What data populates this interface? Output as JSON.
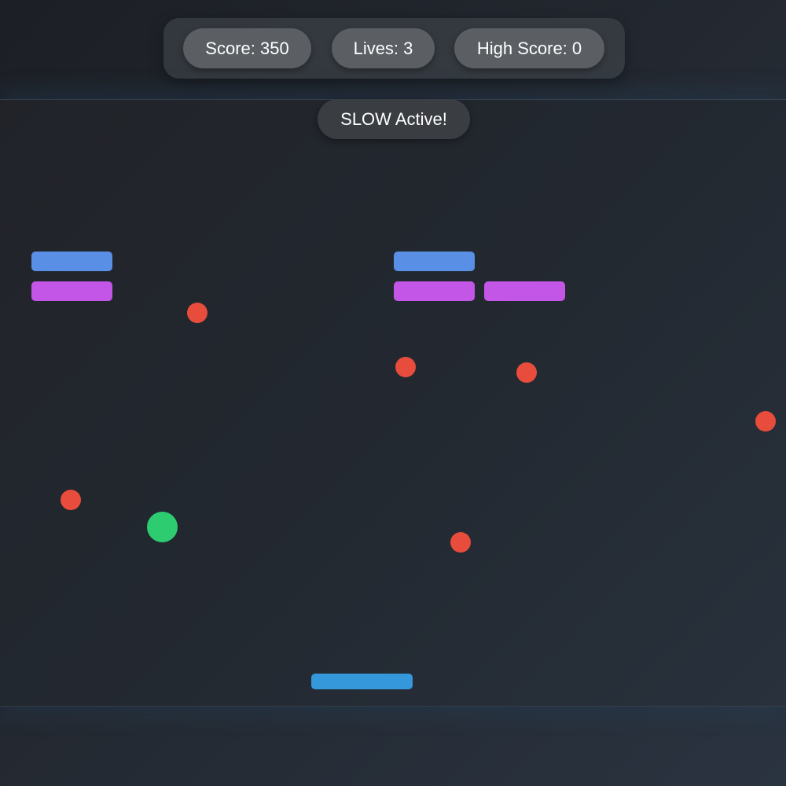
{
  "hud": {
    "score_text": "Score: 350",
    "lives_text": "Lives: 3",
    "high_score_text": "High Score: 0"
  },
  "powerup": {
    "banner_text": "SLOW Active!"
  },
  "colors": {
    "brick_blue": "#5a8fe6",
    "brick_purple": "#c356e6",
    "hazard_ball": "#e74c3c",
    "player_ball": "#2ecc71",
    "paddle": "#3498db"
  }
}
